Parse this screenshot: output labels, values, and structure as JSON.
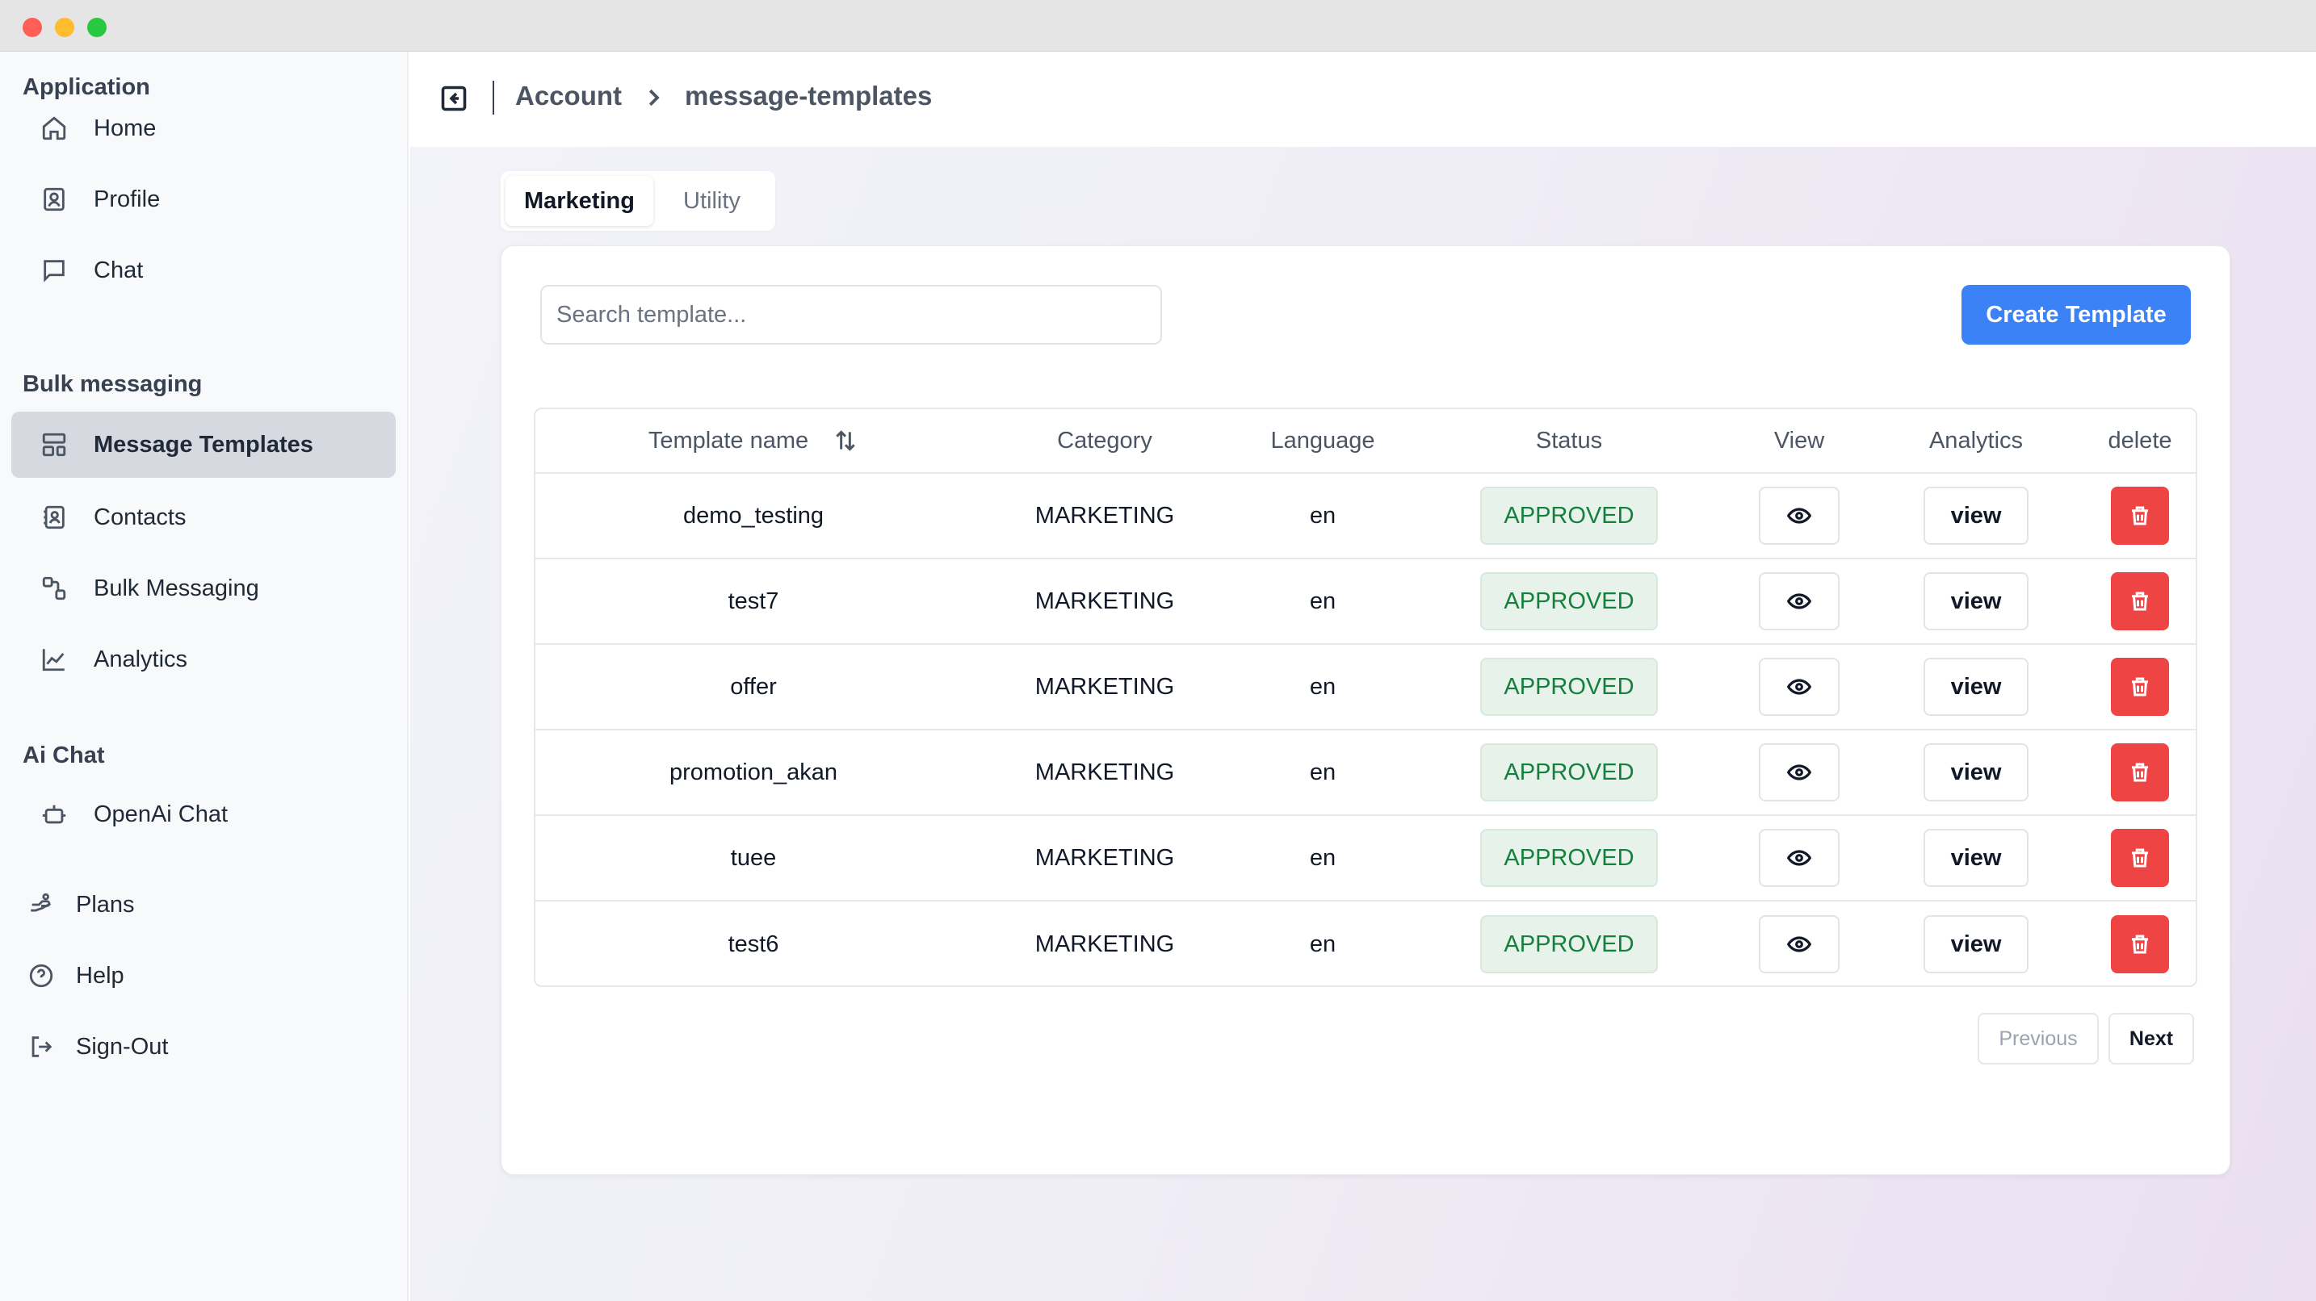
{
  "sidebar": {
    "sections": [
      {
        "title": "Application",
        "items": [
          {
            "label": "Home",
            "icon": "home-icon"
          },
          {
            "label": "Profile",
            "icon": "profile-icon"
          },
          {
            "label": "Chat",
            "icon": "chat-icon"
          }
        ]
      },
      {
        "title": "Bulk messaging",
        "items": [
          {
            "label": "Message Templates",
            "icon": "templates-icon",
            "active": true
          },
          {
            "label": "Contacts",
            "icon": "contacts-icon"
          },
          {
            "label": "Bulk Messaging",
            "icon": "bulk-messaging-icon"
          },
          {
            "label": "Analytics",
            "icon": "analytics-icon"
          }
        ]
      },
      {
        "title": "Ai Chat",
        "items": [
          {
            "label": "OpenAi Chat",
            "icon": "bot-icon"
          }
        ]
      }
    ],
    "footer_items": [
      {
        "label": "Plans",
        "icon": "plans-icon"
      },
      {
        "label": "Help",
        "icon": "help-icon"
      },
      {
        "label": "Sign-Out",
        "icon": "sign-out-icon"
      }
    ],
    "theme_toggle_icon": "sun-icon"
  },
  "header": {
    "breadcrumb": [
      "Account",
      "message-templates"
    ]
  },
  "tabs": [
    {
      "label": "Marketing",
      "active": true
    },
    {
      "label": "Utility",
      "active": false
    }
  ],
  "search": {
    "placeholder": "Search template...",
    "value": ""
  },
  "create_button": "Create Template",
  "table": {
    "columns": [
      "Template name",
      "Category",
      "Language",
      "Status",
      "View",
      "Analytics",
      "delete"
    ],
    "rows": [
      {
        "name": "demo_testing",
        "category": "MARKETING",
        "language": "en",
        "status": "APPROVED",
        "analytics": "view"
      },
      {
        "name": "test7",
        "category": "MARKETING",
        "language": "en",
        "status": "APPROVED",
        "analytics": "view"
      },
      {
        "name": "offer",
        "category": "MARKETING",
        "language": "en",
        "status": "APPROVED",
        "analytics": "view"
      },
      {
        "name": "promotion_akan",
        "category": "MARKETING",
        "language": "en",
        "status": "APPROVED",
        "analytics": "view"
      },
      {
        "name": "tuee",
        "category": "MARKETING",
        "language": "en",
        "status": "APPROVED",
        "analytics": "view"
      },
      {
        "name": "test6",
        "category": "MARKETING",
        "language": "en",
        "status": "APPROVED",
        "analytics": "view"
      }
    ]
  },
  "pagination": {
    "previous": "Previous",
    "next": "Next"
  },
  "colors": {
    "accent": "#3b82f6",
    "approved_text": "#15803d",
    "approved_bg": "#e6f2ea",
    "delete": "#ef4444",
    "active_nav_bg": "#d6d9df"
  }
}
